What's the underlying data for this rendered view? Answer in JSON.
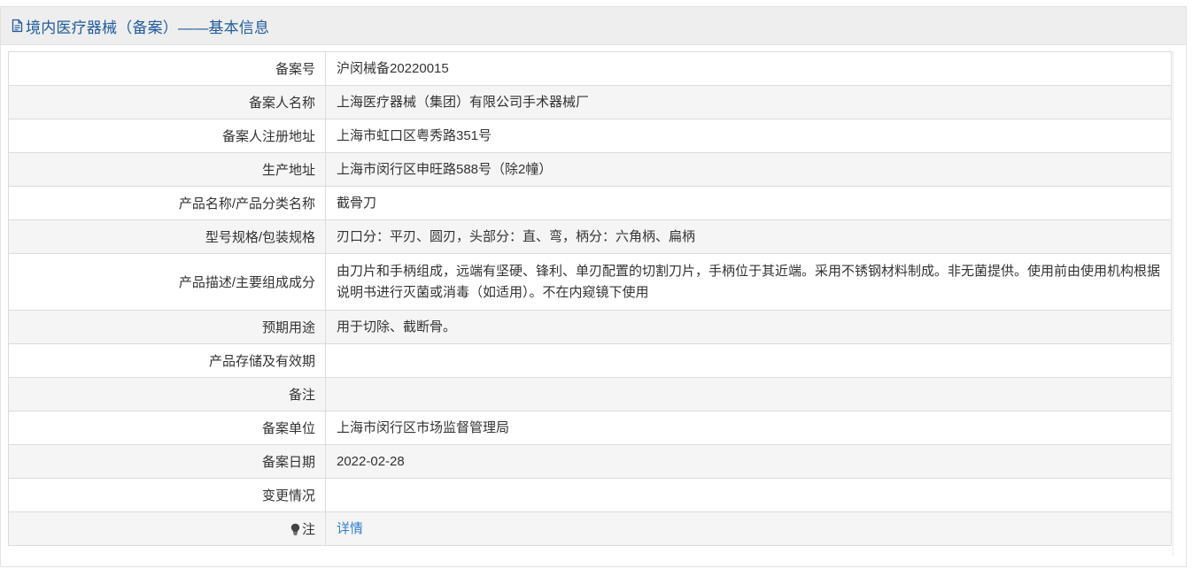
{
  "header": {
    "title": "境内医疗器械（备案）——基本信息",
    "icon": "document-icon"
  },
  "rows": [
    {
      "label": "备案号",
      "value": "沪闵械备20220015"
    },
    {
      "label": "备案人名称",
      "value": "上海医疗器械（集团）有限公司手术器械厂"
    },
    {
      "label": "备案人注册地址",
      "value": "上海市虹口区粤秀路351号"
    },
    {
      "label": "生产地址",
      "value": "上海市闵行区申旺路588号（除2幢）"
    },
    {
      "label": "产品名称/产品分类名称",
      "value": "截骨刀"
    },
    {
      "label": "型号规格/包装规格",
      "value": "刃口分：平刃、圆刃，头部分：直、弯，柄分：六角柄、扁柄"
    },
    {
      "label": "产品描述/主要组成成分",
      "value": "由刀片和手柄组成，远端有坚硬、锋利、单刃配置的切割刀片，手柄位于其近端。采用不锈钢材料制成。非无菌提供。使用前由使用机构根据说明书进行灭菌或消毒（如适用）。不在内窥镜下使用"
    },
    {
      "label": "预期用途",
      "value": "用于切除、截断骨。"
    },
    {
      "label": "产品存储及有效期",
      "value": ""
    },
    {
      "label": "备注",
      "value": ""
    },
    {
      "label": "备案单位",
      "value": "上海市闵行区市场监督管理局"
    },
    {
      "label": "备案日期",
      "value": "2022-02-28"
    },
    {
      "label": "变更情况",
      "value": ""
    }
  ],
  "note_row": {
    "label": "注",
    "icon": "lightbulb-icon",
    "link_text": "详情"
  },
  "colors": {
    "title": "#1f5b9c",
    "link": "#2e7fd0",
    "header_bg": "#eeeeee",
    "row_alt_bg": "#f5f5f5",
    "border": "#dcdcdc"
  }
}
